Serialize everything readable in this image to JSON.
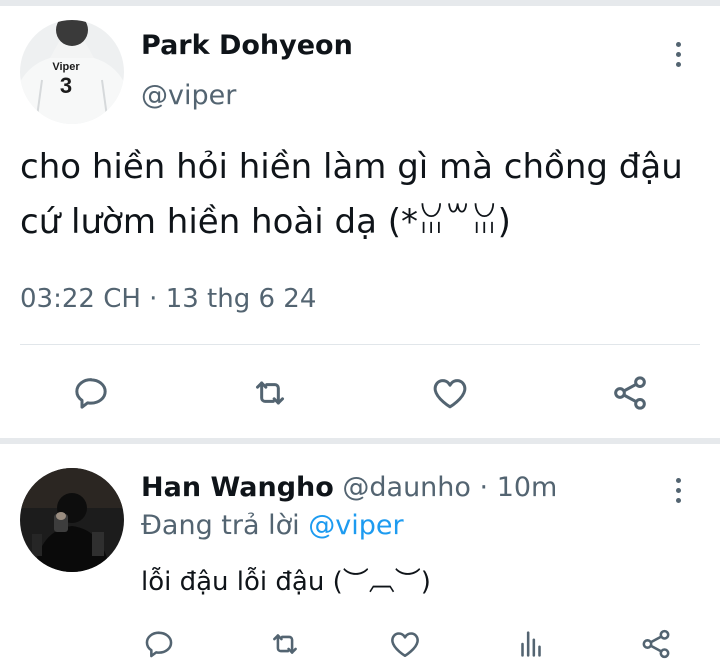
{
  "main_tweet": {
    "display_name": "Park Dohyeon",
    "handle": "@viper",
    "avatar_jersey_name": "Viper",
    "avatar_jersey_number": "3",
    "text": "cho hiền hỏi hiền làm gì mà chồng đậu cứ lườm hiền hoài dạ (*ꈍ꒳ꈍ)",
    "timestamp": "03:22 CH · 13 thg 6 24",
    "actions": [
      "reply-icon",
      "retweet-icon",
      "like-icon",
      "share-icon"
    ]
  },
  "reply_tweet": {
    "display_name": "Han Wangho",
    "handle": "@daunho",
    "separator": " · ",
    "time_ago": "10m",
    "replying_prefix": "Đang trả lời ",
    "replying_to": "@viper",
    "text": "lỗi đậu lỗi đậu (︶︹︶)",
    "actions": [
      "reply-icon",
      "retweet-icon",
      "like-icon",
      "views-icon",
      "share-icon"
    ]
  },
  "colors": {
    "primary_text": "#0f1419",
    "secondary_text": "#536471",
    "link": "#1d9bf0",
    "divider": "#e1e6ea"
  }
}
